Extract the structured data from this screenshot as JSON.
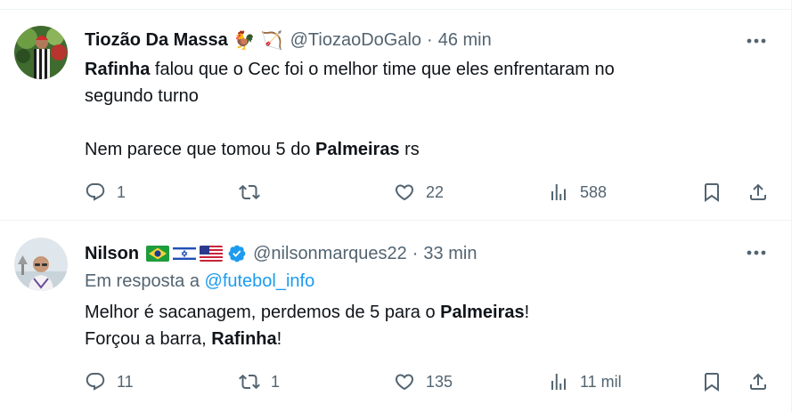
{
  "tweets": [
    {
      "name": "Tiozão Da Massa",
      "emojis": [
        "🐓",
        "🏹"
      ],
      "handle": "@TiozaoDoGalo",
      "separator": "·",
      "time": "46 min",
      "text": {
        "l1_b": "Rafinha",
        "l1_t": " falou que o Cec foi o melhor time que eles enfrentaram no",
        "l2": "segundo turno",
        "l3_t": "Nem parece que tomou 5 do ",
        "l3_b": "Palmeiras",
        "l3_e": " rs"
      },
      "stats": {
        "replies": "1",
        "retweets": "",
        "likes": "22",
        "views": "588"
      }
    },
    {
      "name": "Nilson",
      "flags": [
        "brazil",
        "israel",
        "united-states"
      ],
      "verified": true,
      "handle": "@nilsonmarques22",
      "separator": "·",
      "time": "33 min",
      "reply_prefix": "Em resposta a ",
      "reply_to": "@futebol_info",
      "text": {
        "l1_t": "Melhor é sacanagem, perdemos de 5 para o ",
        "l1_b": "Palmeiras",
        "l1_e": "!",
        "l2_t": "Forçou a barra, ",
        "l2_b": "Rafinha",
        "l2_e": "!"
      },
      "stats": {
        "replies": "11",
        "retweets": "1",
        "likes": "135",
        "views": "11 mil"
      }
    }
  ],
  "colors": {
    "secondary_text": "#536471",
    "link": "#1d9bf0",
    "verified": "#1d9bf0",
    "divider": "#eff3f4"
  },
  "icons": [
    "more-icon",
    "reply-icon",
    "retweet-icon",
    "like-icon",
    "views-icon",
    "bookmark-icon",
    "share-icon",
    "verified-badge-icon"
  ]
}
